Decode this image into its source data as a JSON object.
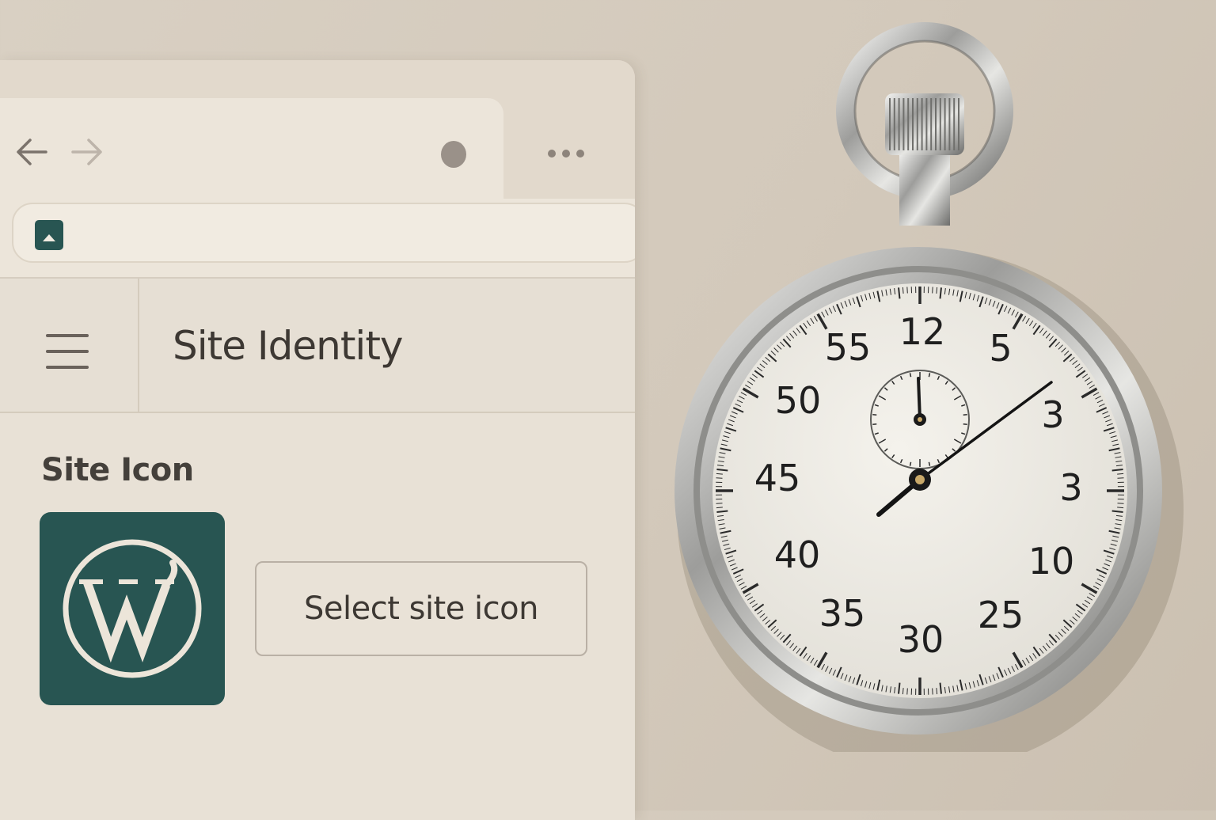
{
  "header": {
    "title": "Site Identity"
  },
  "section": {
    "label": "Site Icon",
    "select_button_label": "Select site icon"
  },
  "stopwatch": {
    "dial_numbers": [
      "12",
      "5",
      "3",
      "3",
      "10",
      "25",
      "30",
      "35",
      "40",
      "45",
      "50",
      "55"
    ]
  },
  "icons": {
    "back": "arrow-left-icon",
    "forward": "arrow-right-icon",
    "more": "more-dots-icon",
    "menu": "hamburger-icon",
    "favicon": "image-icon",
    "site_icon": "wordpress-logo-icon"
  },
  "colors": {
    "brand": "#285552",
    "background": "#d6cdc0",
    "panel": "#e8e1d6",
    "text": "#3d3833"
  }
}
